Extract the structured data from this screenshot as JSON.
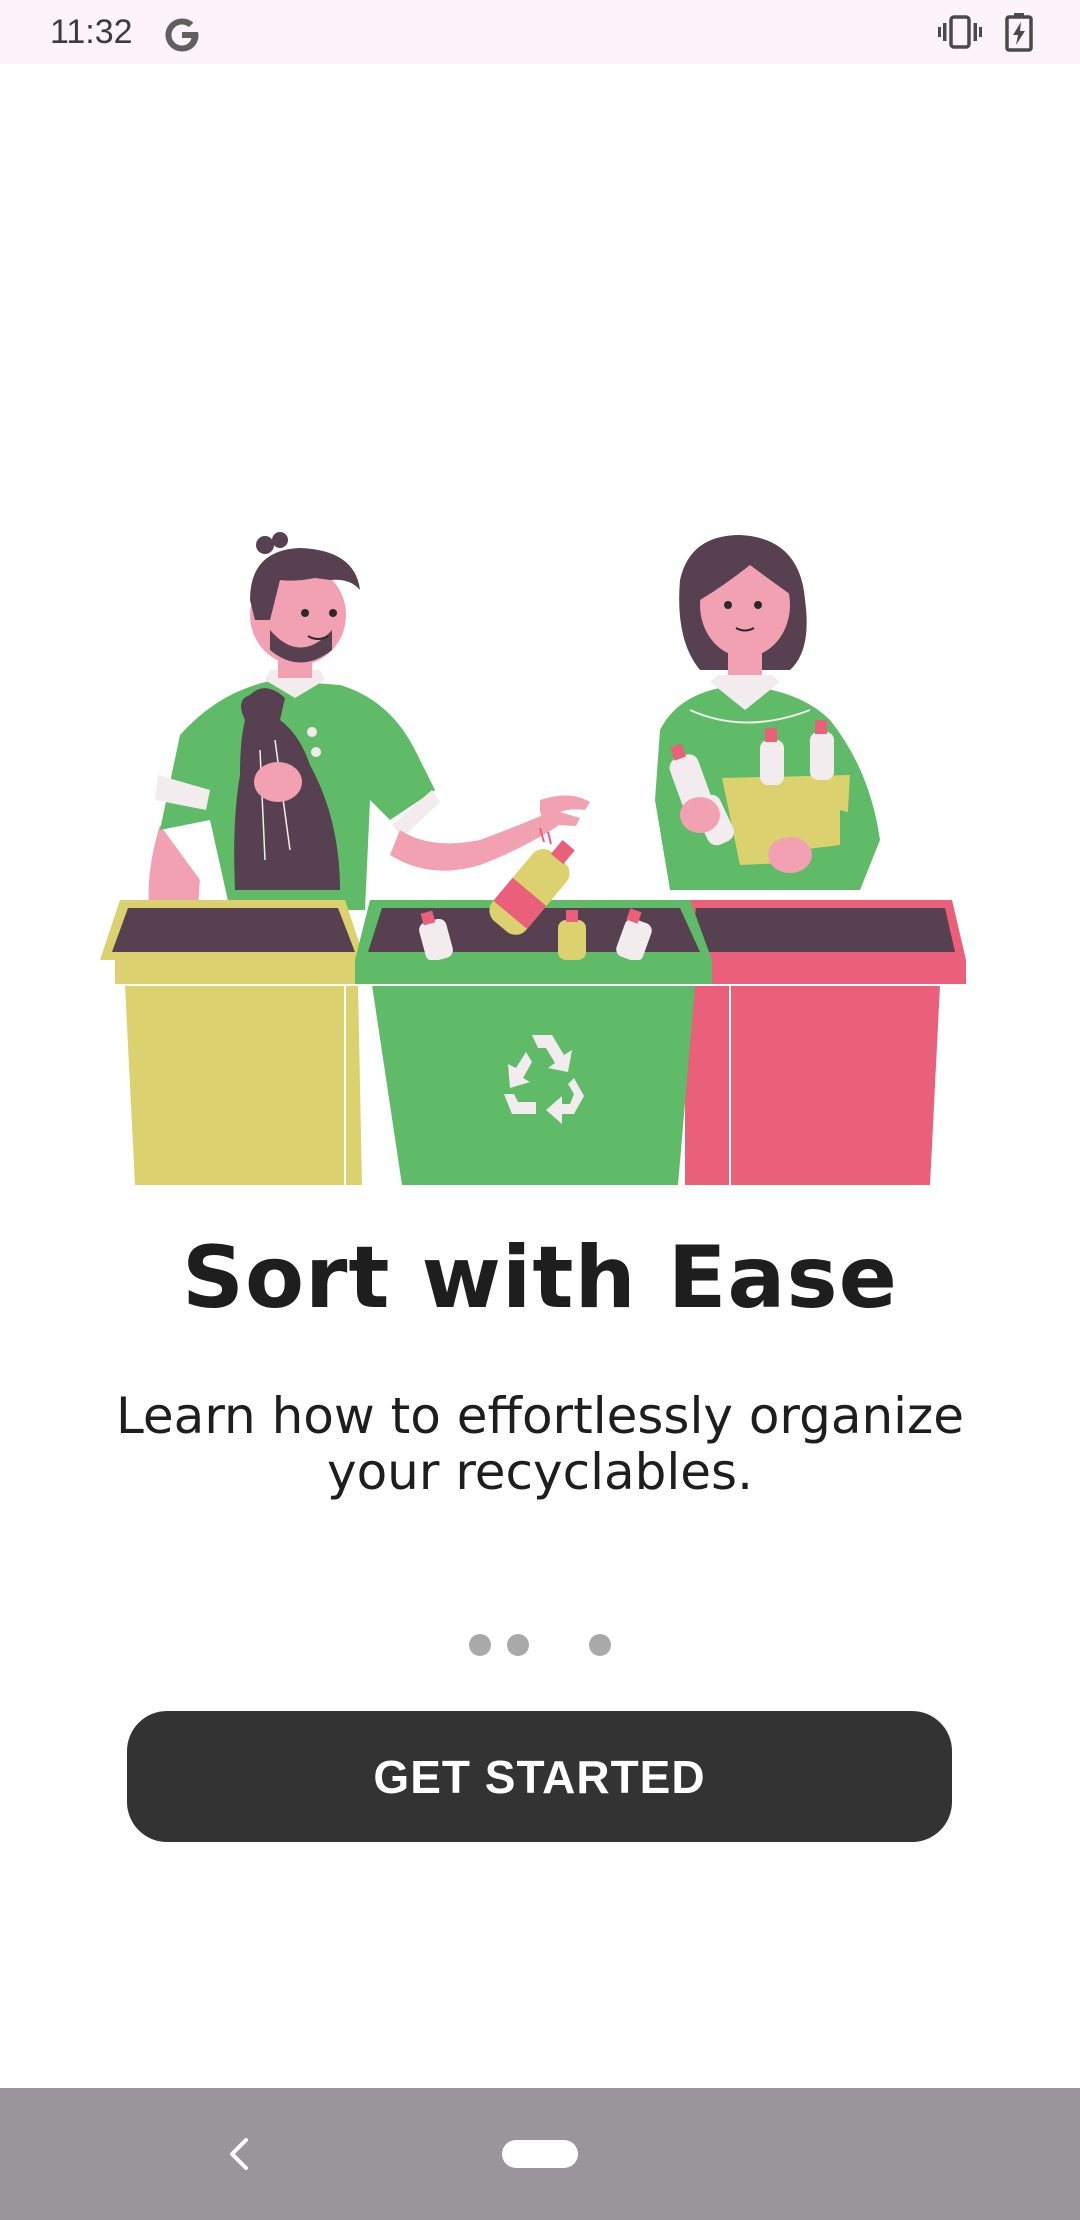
{
  "status_bar": {
    "time": "11:32",
    "icons": [
      "google-g-icon",
      "vibrate-icon",
      "battery-charging-icon"
    ]
  },
  "onboarding": {
    "illustration": "recycling-people-bins-illustration",
    "title": "Sort with Ease",
    "subtitle": "Learn how to effortlessly organize your recyclables.",
    "page_indicator": {
      "total_pages": 3
    },
    "cta_label": "GET STARTED"
  },
  "nav_bar": {
    "icons": [
      "back-icon",
      "home-pill-icon"
    ]
  },
  "colors": {
    "button_bg": "#333333",
    "bin_yellow": "#dcd16f",
    "bin_green": "#5fbb68",
    "bin_red": "#ea5f7a",
    "shirt_green": "#5fbb68",
    "skin_pink": "#f1a1b2",
    "hair_dark": "#574050"
  }
}
